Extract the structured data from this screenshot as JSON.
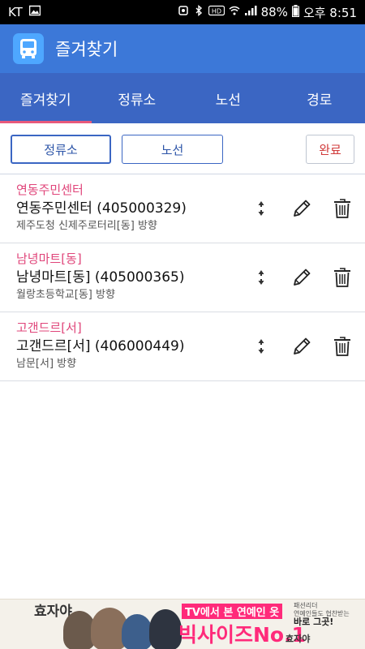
{
  "status_bar": {
    "carrier": "KT",
    "battery": "88%",
    "time": "오후 8:51"
  },
  "app_bar": {
    "title": "즐겨찾기",
    "icon": "bus-icon"
  },
  "tabs": [
    {
      "label": "즐겨찾기",
      "active": true
    },
    {
      "label": "정류소",
      "active": false
    },
    {
      "label": "노선",
      "active": false
    },
    {
      "label": "경로",
      "active": false
    }
  ],
  "filter": {
    "stop_label": "정류소",
    "route_label": "노선",
    "done_label": "완료"
  },
  "favorites": [
    {
      "name": "연동주민센터",
      "title": "연동주민센터 (405000329)",
      "direction": "제주도청 신제주로터리[동] 방향"
    },
    {
      "name": "남녕마트[동]",
      "title": "남녕마트[동] (405000365)",
      "direction": "월랑초등학교[동] 방향"
    },
    {
      "name": "고갠드르[서]",
      "title": "고갠드르[서] (406000449)",
      "direction": "남문[서] 방향"
    }
  ],
  "ad": {
    "logo": "효자야",
    "tag": "TV에서 본 연예인 옷",
    "headline": "빅사이즈No.1",
    "side_line1": "패션리더",
    "side_line2": "연예인들도 협찬받는",
    "side_line3": "바로 그곳!",
    "brand": "효자야"
  },
  "colors": {
    "app_bar": "#3c78d8",
    "tab_bar": "#3b66c3",
    "accent_pink": "#e0457a",
    "done_red": "#d03a3a"
  }
}
